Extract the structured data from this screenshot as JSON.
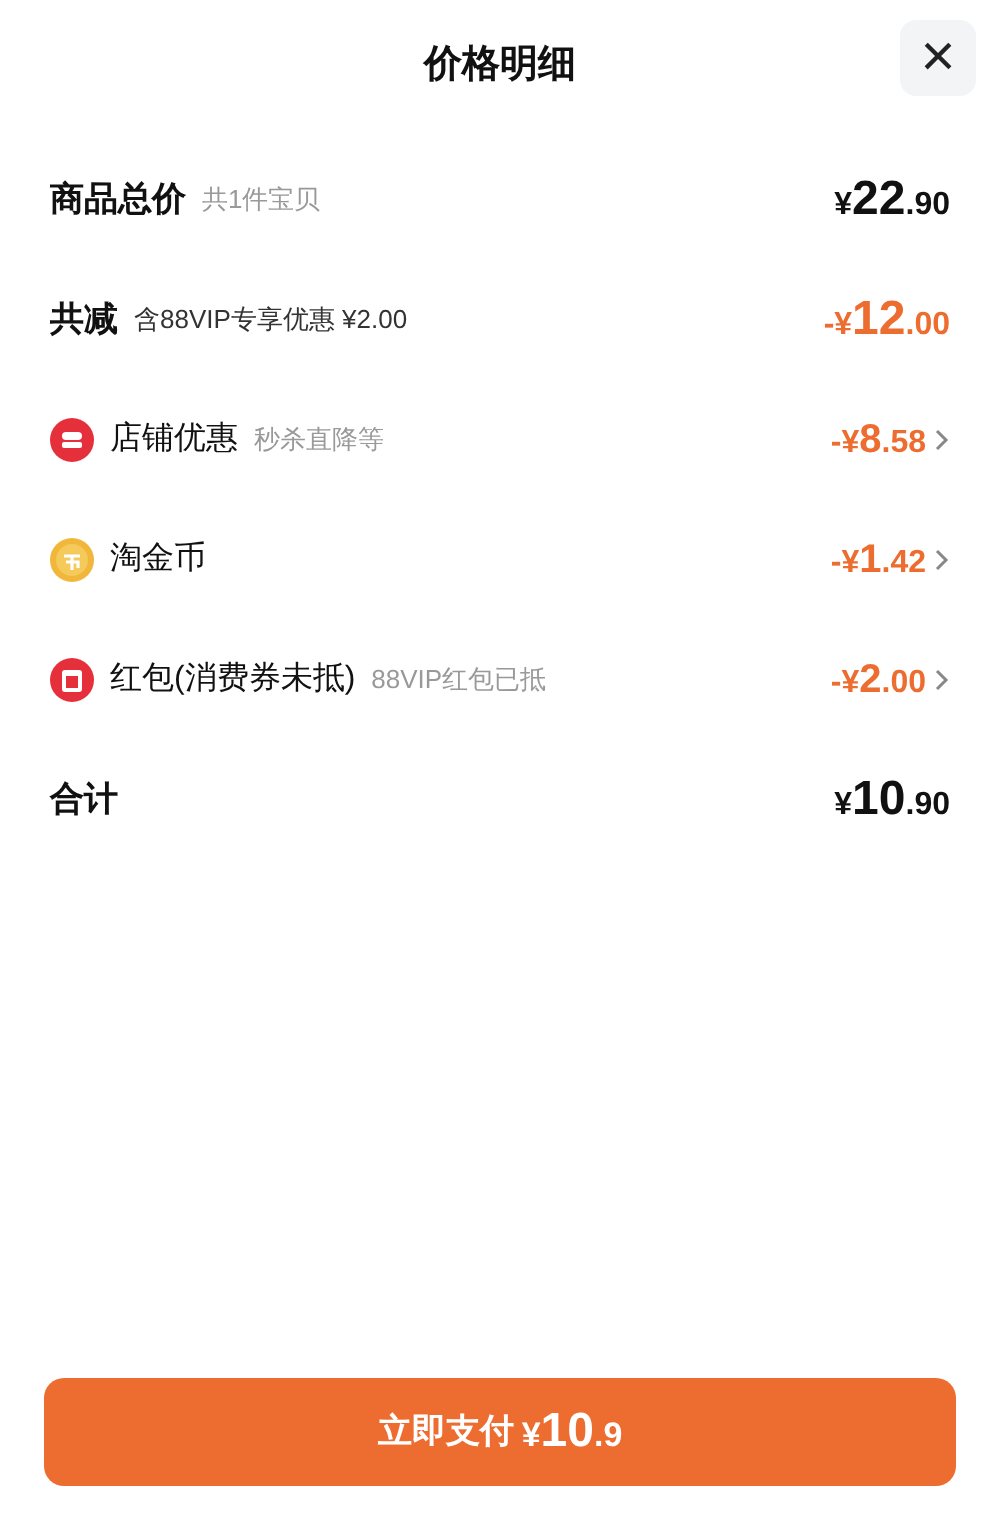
{
  "header": {
    "title": "价格明细",
    "close": "×"
  },
  "rows": [
    {
      "kind": "summary",
      "label": "商品总价",
      "note": "共1件宝贝",
      "amount": "¥22.90",
      "color": "#111111"
    },
    {
      "kind": "summary",
      "label": "共减",
      "note": "含88VIP专享优惠 ¥2.00",
      "amount": "-¥12.00",
      "color": "#ec6d2f"
    },
    {
      "kind": "shop",
      "label": "店铺优惠",
      "note": "秒杀直降等",
      "amount": "-¥8.58",
      "color": "#ec6d2f",
      "chevron": true
    },
    {
      "kind": "coin",
      "label": "淘金币",
      "amount": "-¥1.42",
      "color": "#ec6d2f",
      "chevron": true
    },
    {
      "kind": "voucher",
      "label": "红包(消费券未抵)",
      "note": "88VIP红包已抵",
      "amount": "-¥2.00",
      "color": "#ec6d2f",
      "chevron": true
    },
    {
      "kind": "summary",
      "label": "合计",
      "amount": "¥10.90",
      "color": "#111111"
    }
  ],
  "pay_button": {
    "label": "立即支付",
    "amount": "¥10.9"
  }
}
